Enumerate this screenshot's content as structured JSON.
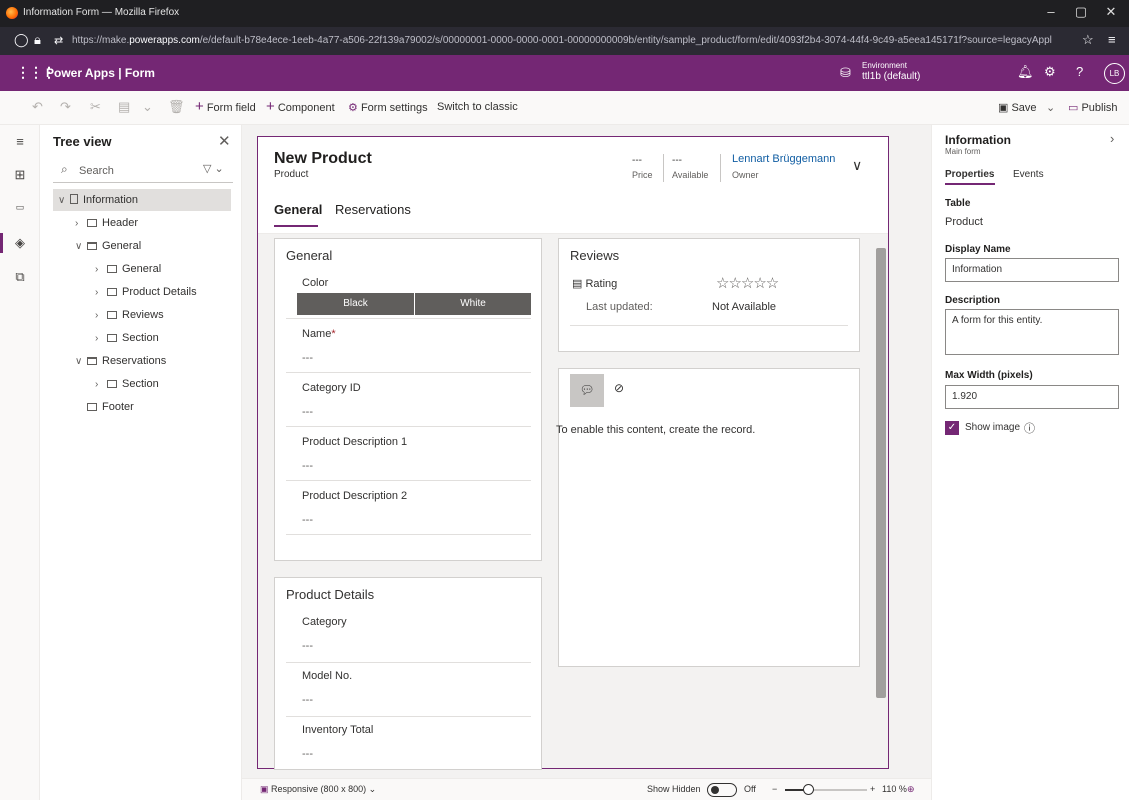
{
  "browser": {
    "window_title": "Information Form — Mozilla Firefox",
    "url_prefix": "https://make.",
    "url_domain": "powerapps.com",
    "url_rest": "/e/default-b78e4ece-1eeb-4a77-a506-22f139a79002/s/00000001-0000-0000-0001-00000000009b/entity/sample_product/form/edit/4093f2b4-3074-44f4-9c49-a5eea145171f?source=legacyAppl"
  },
  "app_header": {
    "waffle": "⠿",
    "brand": "Power Apps  |  Form",
    "environment_label": "Environment",
    "environment_value": "ttl1b (default)",
    "avatar": "LB"
  },
  "command_bar": {
    "form_field": "Form field",
    "component": "Component",
    "form_settings": "Form settings",
    "switch_classic": "Switch to classic",
    "save": "Save",
    "publish": "Publish"
  },
  "tree": {
    "title": "Tree view",
    "search_placeholder": "Search",
    "nodes": [
      {
        "label": "Information"
      },
      {
        "label": "Header"
      },
      {
        "label": "General"
      },
      {
        "label": "General"
      },
      {
        "label": "Product Details"
      },
      {
        "label": "Reviews"
      },
      {
        "label": "Section"
      },
      {
        "label": "Reservations"
      },
      {
        "label": "Section"
      },
      {
        "label": "Footer"
      }
    ]
  },
  "form": {
    "title": "New Product",
    "subtitle": "Product",
    "header_fields": [
      {
        "value": "---",
        "label": "Price"
      },
      {
        "value": "---",
        "label": "Available"
      }
    ],
    "owner_value": "Lennart Brüggemann",
    "owner_label": "Owner",
    "tabs": [
      "General",
      "Reservations"
    ],
    "general": {
      "heading": "General",
      "color_label": "Color",
      "color_options": [
        "Black",
        "White"
      ],
      "name_label": "Name",
      "name_required": "*",
      "name_value": "---",
      "category_id_label": "Category ID",
      "category_id_value": "---",
      "desc1_label": "Product Description 1",
      "desc1_value": "---",
      "desc2_label": "Product Description 2",
      "desc2_value": "---"
    },
    "reviews": {
      "heading": "Reviews",
      "rating_label": "Rating",
      "stars": "☆☆☆☆☆",
      "updated_label": "Last updated:",
      "updated_value": "Not Available"
    },
    "timeline": {
      "message": "To enable this content, create the record."
    },
    "product_details": {
      "heading": "Product Details",
      "category_label": "Category",
      "category_value": "---",
      "model_label": "Model No.",
      "model_value": "---",
      "inventory_label": "Inventory Total",
      "inventory_value": "---"
    }
  },
  "status_bar": {
    "responsive": "Responsive (800 x 800)",
    "show_hidden": "Show Hidden",
    "toggle_state": "Off",
    "zoom": "110 %"
  },
  "properties_panel": {
    "title": "Information",
    "subtitle": "Main form",
    "tabs": [
      "Properties",
      "Events"
    ],
    "table_label": "Table",
    "table_value": "Product",
    "display_name_label": "Display Name",
    "display_name_value": "Information",
    "description_label": "Description",
    "description_value": "A form for this entity.",
    "max_width_label": "Max Width (pixels)",
    "max_width_value": "1.920",
    "show_image_label": "Show image"
  },
  "colors": {
    "brand": "#742774",
    "browser_chrome": "#1f1f22",
    "link": "#115ea3"
  }
}
